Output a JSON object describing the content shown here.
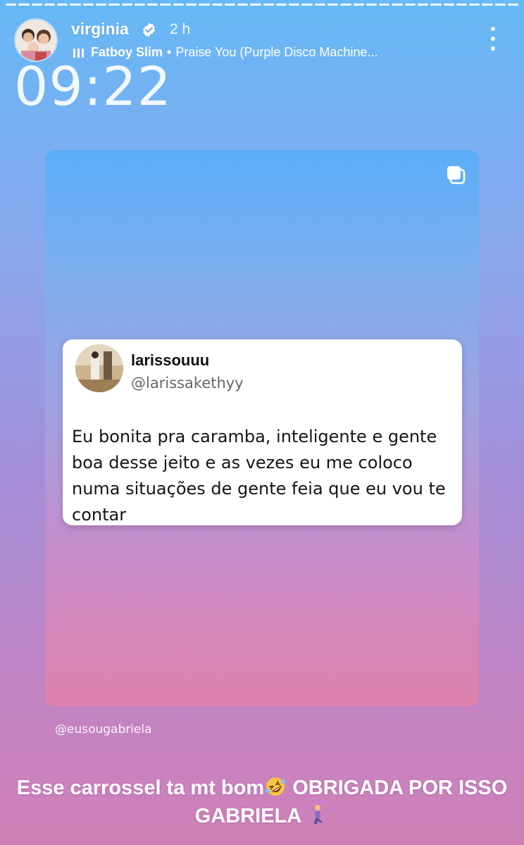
{
  "story": {
    "progress_segments": 40,
    "header": {
      "username": "virginia",
      "verified_icon": "verified-badge-icon",
      "time_ago": "2 h",
      "music": {
        "icon": "music-bars-icon",
        "artist": "Fatboy Slim",
        "separator": "•",
        "track": "Praise You (Purple Disco Machine..."
      },
      "more_icon": "more-options-icon"
    },
    "clock": "09:22",
    "post": {
      "carousel_icon": "carousel-icon",
      "tweet": {
        "display_name": "larissouuu",
        "handle": "@larissakethyy",
        "text": "Eu bonita pra caramba, inteligente e gente boa desse jeito e as vezes eu me coloco numa situações de gente feia que eu vou te contar"
      }
    },
    "mention": "@eusougabriela",
    "caption": {
      "part1": "Esse carrossel ta mt bom",
      "emoji1": "rolling-on-floor-laughing-emoji",
      "part2": "OBRIGADA POR ISSO GABRIELA",
      "emoji2": "person-kneeling-emoji"
    },
    "colors": {
      "background_top": "#65b9f5",
      "background_bottom": "#cf80b8",
      "text": "#ffffff"
    }
  }
}
